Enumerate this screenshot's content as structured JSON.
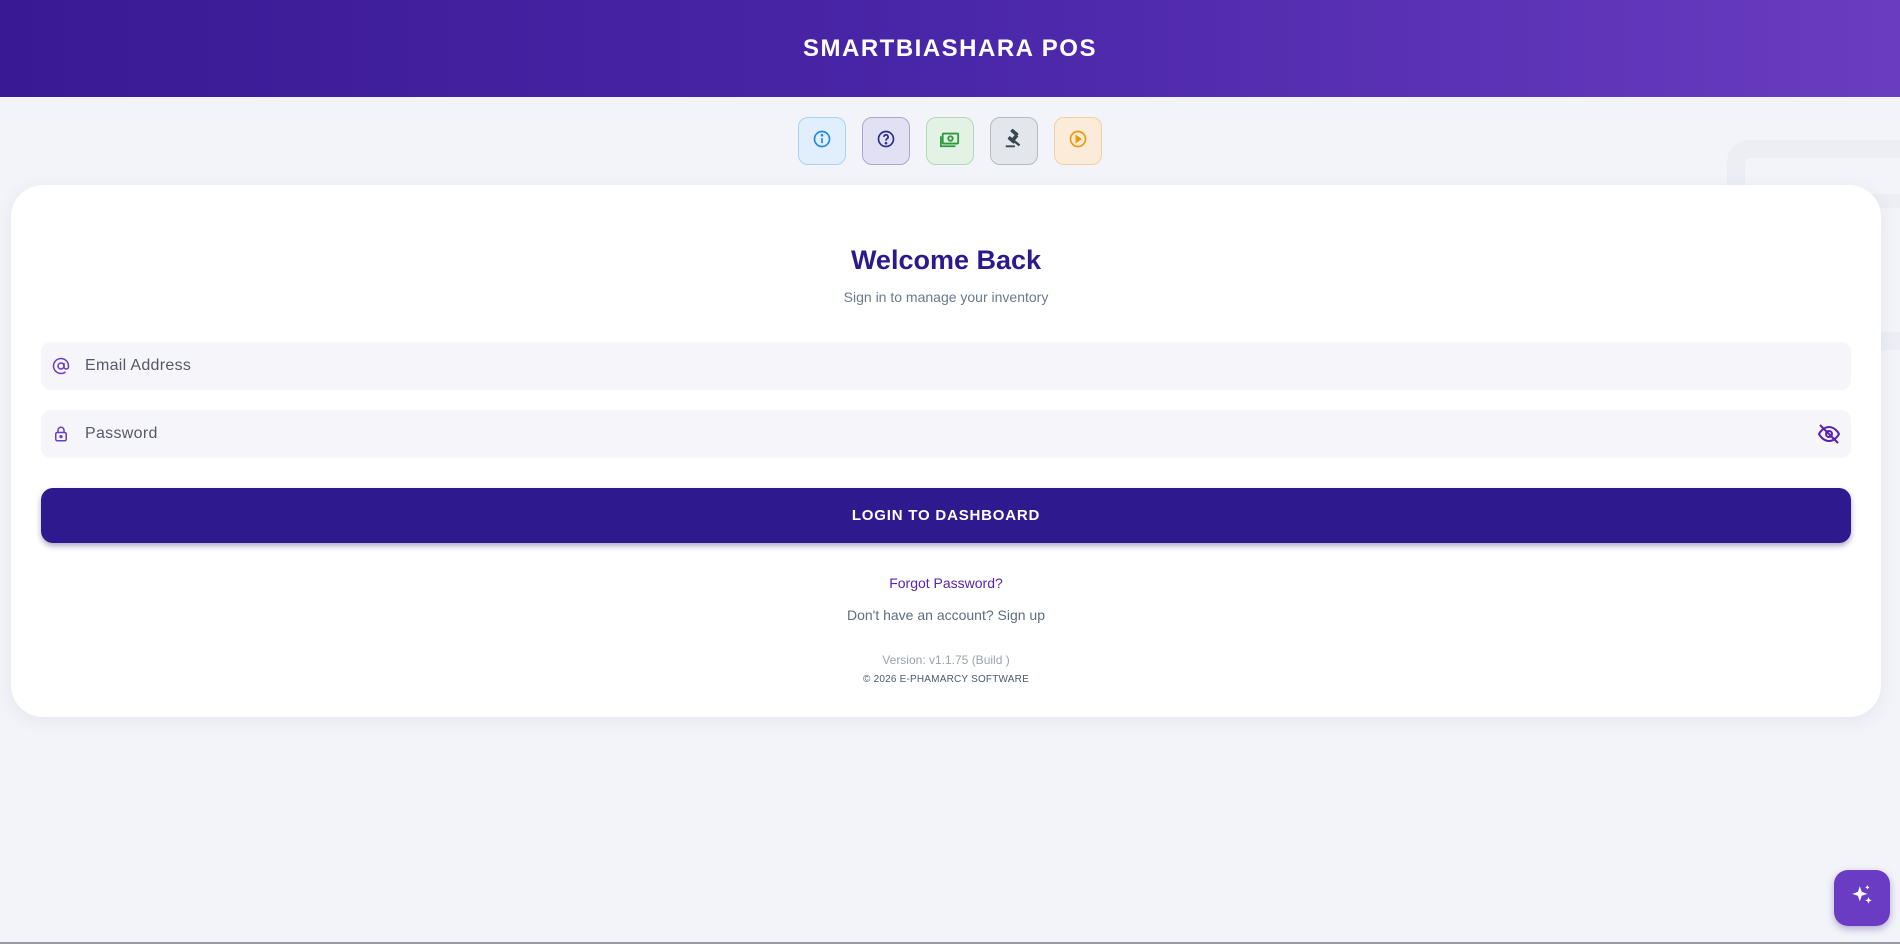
{
  "app": {
    "title": "SMARTBIASHARA POS"
  },
  "quick_actions": [
    {
      "icon": "info-icon",
      "color": "#1e88e5"
    },
    {
      "icon": "help-icon",
      "color": "#2c2a8c"
    },
    {
      "icon": "money-icon",
      "color": "#2e9a3e"
    },
    {
      "icon": "gavel-icon",
      "color": "#37474f"
    },
    {
      "icon": "play-icon",
      "color": "#f0960a"
    }
  ],
  "login": {
    "heading": "Welcome Back",
    "subheading": "Sign in to manage your inventory",
    "email_placeholder": "Email Address",
    "password_placeholder": "Password",
    "submit_label": "LOGIN TO DASHBOARD",
    "forgot_label": "Forgot Password?",
    "signup_prompt": "Don't have an account? Sign up"
  },
  "footer": {
    "version": "Version: v1.1.75 (Build )",
    "copyright": "© 2026 E-PHAMARCY SOFTWARE"
  },
  "colors": {
    "primary": "#2e1a8e",
    "accent": "#6a3cc4"
  }
}
